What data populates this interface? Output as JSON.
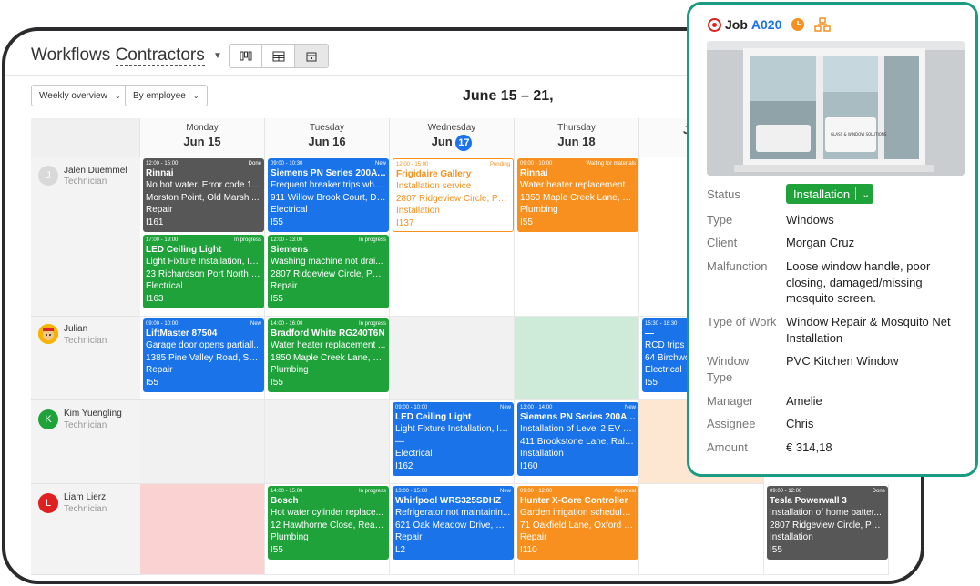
{
  "header": {
    "title_prefix": "Workflows",
    "title_selected": "Contractors",
    "caret": "⌄",
    "view_modes": [
      "kanban-icon",
      "table-icon",
      "calendar-icon"
    ],
    "overview_dropdown": "Weekly overview",
    "group_dropdown": "By employee",
    "week_range": "June 15 – 21,"
  },
  "days": [
    {
      "dow": "Monday",
      "date": "Jun 15",
      "today": false
    },
    {
      "dow": "Tuesday",
      "date": "Jun 16",
      "today": false
    },
    {
      "dow": "Wednesday",
      "date_prefix": "Jun",
      "date_num": "17",
      "today": true
    },
    {
      "dow": "Thursday",
      "date": "Jun 18",
      "today": false
    },
    {
      "dow": "",
      "date": "J",
      "today": false
    }
  ],
  "employees": [
    {
      "name": "Jalen Duemmel",
      "role": "Technician",
      "initial": "J",
      "avatar_color": "#d9d9d9"
    },
    {
      "name": "Julian",
      "role": "Technician",
      "initial": "",
      "avatar_color": "#f5b400"
    },
    {
      "name": "Kim Yuengling",
      "role": "Technician",
      "initial": "K",
      "avatar_color": "#1fa23a"
    },
    {
      "name": "Liam Lierz",
      "role": "Technician",
      "initial": "L",
      "avatar_color": "#e02020"
    }
  ],
  "cards": {
    "c1": {
      "time": "12:00 - 15:00",
      "status": "Done",
      "title": "Rinnai",
      "l1": "No hot water. Error code 1...",
      "l2": "Morston Point, Old Marsh ...",
      "l3": "Repair",
      "l4": "I161"
    },
    "c2": {
      "time": "09:00 - 10:30",
      "status": "New",
      "title": "Siemens PN Series 200A L...",
      "l1": "Frequent breaker trips whe...",
      "l2": "911 Willow Brook Court, De...",
      "l3": "Electrical",
      "l4": "I55"
    },
    "c3": {
      "time": "12:00 - 15:00",
      "status": "Pending",
      "title": "Frigidaire Gallery",
      "l1": "Installation service",
      "l2": "2807 Ridgeview Circle, Pho...",
      "l3": "Installation",
      "l4": "I137"
    },
    "c4": {
      "time": "09:00 - 10:00",
      "status": "Waiting for materials",
      "title": "Rinnai",
      "l1": "Water heater replacement ...",
      "l2": "1850 Maple Creek Lane, Ch...",
      "l3": "Plumbing",
      "l4": "I55"
    },
    "c5": {
      "time": "17:00 - 19:00",
      "status": "In progress",
      "title": "LED Ceiling Light",
      "l1": "Light Fixture Installation, In...",
      "l2": "23 Richardson Port North J...",
      "l3": "Electrical",
      "l4": "I163"
    },
    "c6": {
      "time": "12:00 - 13:00",
      "status": "In progress",
      "title": "Siemens",
      "l1": "Washing machine not drai...",
      "l2": "2807 Ridgeview Circle, Pho...",
      "l3": "Repair",
      "l4": "I55"
    },
    "c7": {
      "time": "09:00 - 10:00",
      "status": "New",
      "title": "LiftMaster 87504",
      "l1": "Garage door opens partiall...",
      "l2": "1385 Pine Valley Road, Sacr...",
      "l3": "Repair",
      "l4": "I55"
    },
    "c8": {
      "time": "14:00 - 16:00",
      "status": "In progress",
      "title": "Bradford White RG240T6N",
      "l1": "Water heater replacement ...",
      "l2": "1850 Maple Creek Lane, Ch...",
      "l3": "Plumbing",
      "l4": "I55"
    },
    "c9": {
      "time": "15:30 - 18:30",
      "status": "",
      "title": "—",
      "l1": "RCD trips in",
      "l2": "64 Birchwoo",
      "l3": "Electrical",
      "l4": "I55"
    },
    "c10": {
      "time": "09:00 - 10:00",
      "status": "New",
      "title": "LED Ceiling Light",
      "l1": "Light Fixture Installation, In...",
      "l2": "—",
      "l3": "Electrical",
      "l4": "I162"
    },
    "c11": {
      "time": "13:00 - 14:00",
      "status": "New",
      "title": "Siemens PN Series 200A L...",
      "l1": "Installation of Level 2 EV ch...",
      "l2": "411 Brookstone Lane, Ralei...",
      "l3": "Installation",
      "l4": "I160"
    },
    "c12": {
      "time": "14:00 - 15:00",
      "status": "In progress",
      "title": "Bosch",
      "l1": "Hot water cylinder replace...",
      "l2": "12 Hawthorne Close, Readi...",
      "l3": "Plumbing",
      "l4": "I55"
    },
    "c13": {
      "time": "13:00 - 15:00",
      "status": "New",
      "title": "Whirlpool WRS325SDHZ",
      "l1": "Refrigerator not maintainin...",
      "l2": "621 Oak Meadow Drive, Na...",
      "l3": "Repair",
      "l4": "L2"
    },
    "c14": {
      "time": "09:00 - 12:00",
      "status": "Approval",
      "title": "Hunter X-Core Controller",
      "l1": "Garden irrigation schedule ...",
      "l2": "71 Oakfield Lane, Oxford O...",
      "l3": "Repair",
      "l4": "I110"
    },
    "c15": {
      "time": "09:00 - 12:00",
      "status": "Done",
      "title": "Tesla Powerwall 3",
      "l1": "Installation of home batter...",
      "l2": "2807 Ridgeview Circle, Pho...",
      "l3": "Installation",
      "l4": "I55"
    }
  },
  "panel": {
    "job_label": "Job",
    "job_id": "A020",
    "status_label": "Status",
    "status_value": "Installation",
    "fields": [
      {
        "label": "Type",
        "value": "Windows"
      },
      {
        "label": "Client",
        "value": "Morgan Cruz"
      },
      {
        "label": "Malfunction",
        "value": "Loose window handle, poor closing, damaged/missing mosquito screen."
      },
      {
        "label": "Type of Work",
        "value": "Window Repair & Mosquito Net Installation"
      },
      {
        "label": "Window Type",
        "value": "PVC Kitchen Window"
      },
      {
        "label": "Manager",
        "value": "Amelie"
      },
      {
        "label": "Assignee",
        "value": "Chris"
      },
      {
        "label": "Amount",
        "value": "€ 314,18"
      }
    ],
    "photo_van_text": "GLASS & WINDOW SOLUTIONS"
  },
  "colors": {
    "accent": "#1a73e8",
    "done": "#575757",
    "new": "#1a73e8",
    "in_progress": "#1fa23a",
    "waiting": "#f7901e",
    "panel_border": "#1b9b82"
  }
}
